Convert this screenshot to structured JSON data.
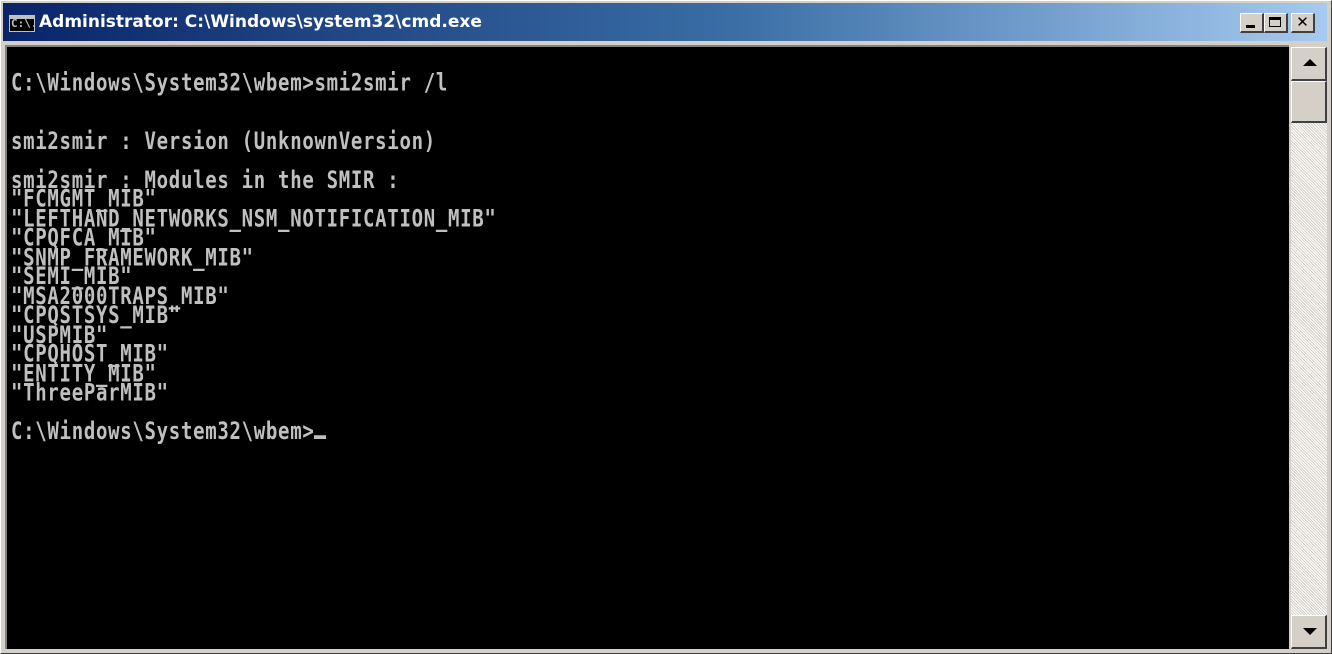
{
  "window": {
    "title": "Administrator: C:\\Windows\\system32\\cmd.exe",
    "icon_label": "C:\\.",
    "icon": "console-icon",
    "controls": {
      "minimize_icon": "minimize-icon",
      "maximize_icon": "maximize-icon",
      "close_icon": "close-icon",
      "close_glyph": "✕"
    }
  },
  "console": {
    "text_color": "#c0c0c0",
    "background": "#000000",
    "command_line": "C:\\Windows\\System32\\wbem>smi2smir /l",
    "version_line": "smi2smir : Version (UnknownVersion)",
    "modules_header": "smi2smir : Modules in the SMIR :",
    "modules": [
      "\"FCMGMT_MIB\"",
      "\"LEFTHAND_NETWORKS_NSM_NOTIFICATION_MIB\"",
      "\"CPQFCA_MIB\"",
      "\"SNMP_FRAMEWORK_MIB\"",
      "\"SEMI_MIB\"",
      "\"MSA2000TRAPS_MIB\"",
      "\"CPQSTSYS_MIB\"",
      "\"USPMIB\"",
      "\"CPQHOST_MIB\"",
      "\"ENTITY_MIB\"",
      "\"ThreeParMIB\""
    ],
    "prompt": "C:\\Windows\\System32\\wbem>"
  },
  "scrollbar": {
    "up_icon": "scroll-up-arrow-icon",
    "down_icon": "scroll-down-arrow-icon"
  }
}
